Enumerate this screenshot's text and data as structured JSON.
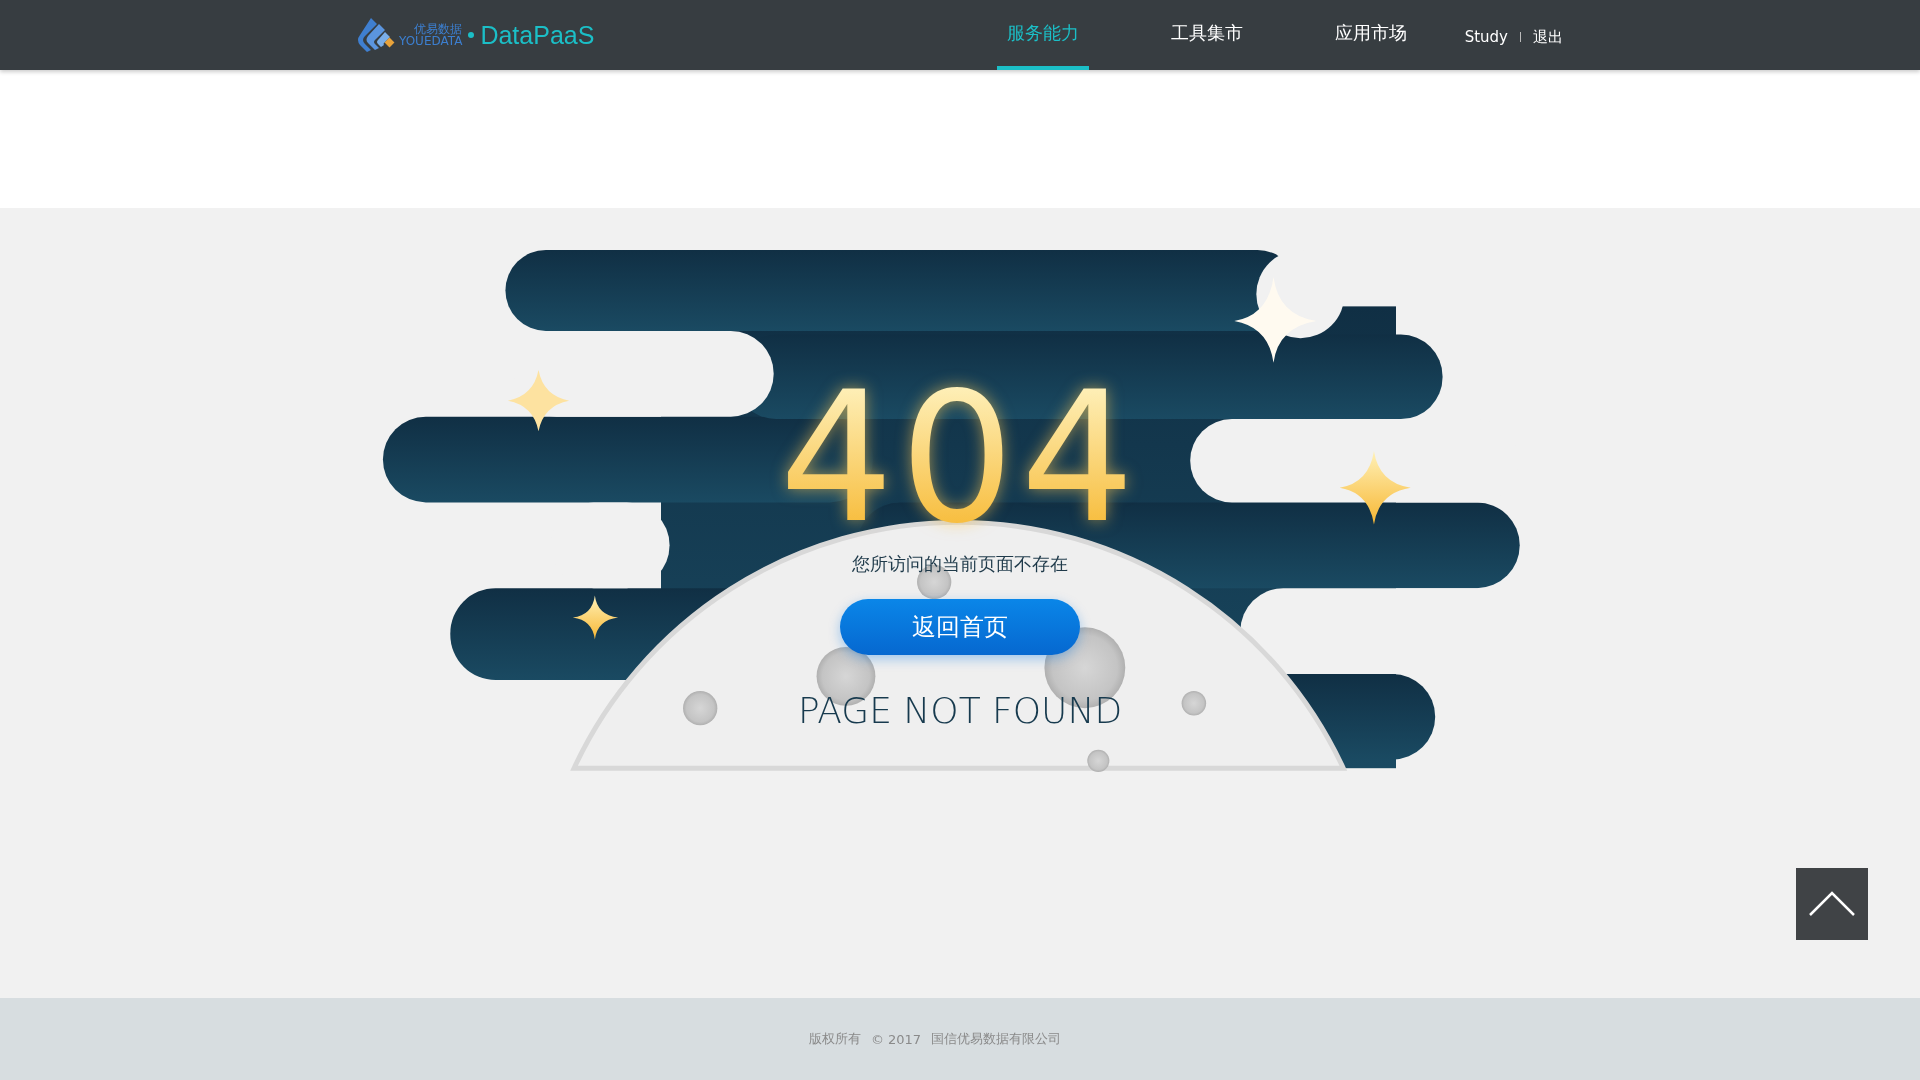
{
  "header": {
    "logo": {
      "chinese": "优易数据",
      "english": "YOUEDATA",
      "product": "DataPaaS"
    },
    "nav": [
      {
        "label": "服务能力",
        "selected": true
      },
      {
        "label": "工具集市",
        "selected": false
      },
      {
        "label": "应用市场",
        "selected": false
      }
    ],
    "user": "Study",
    "logout": "退出"
  },
  "error": {
    "code": "404",
    "message": "您所访问的当前页面不存在",
    "button": "返回首页",
    "caption": "PAGE NOT FOUND"
  },
  "footer": {
    "parts": [
      "版权所有",
      "© 2017",
      "国信优易数据有限公司"
    ]
  }
}
